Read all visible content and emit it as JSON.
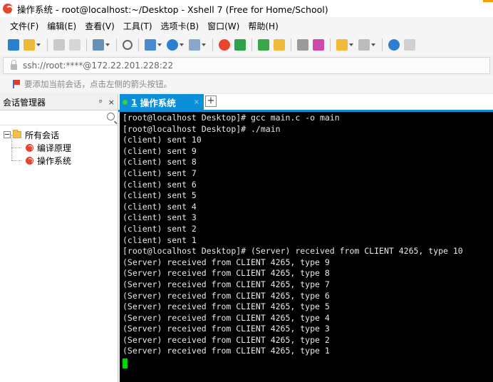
{
  "window": {
    "title": "操作系统 - root@localhost:~/Desktop - Xshell 7 (Free for Home/School)",
    "brand_color": "#e8452c"
  },
  "menu": [
    "文件(F)",
    "编辑(E)",
    "查看(V)",
    "工具(T)",
    "选项卡(B)",
    "窗口(W)",
    "帮助(H)"
  ],
  "toolbar": {
    "icons": [
      "new-session-icon",
      "open-folder-icon",
      "link-icon",
      "unlink-icon",
      "properties-icon",
      "find-icon",
      "transfer-icon",
      "globe-icon",
      "font-icon",
      "xshell-icon",
      "xftp-icon",
      "fullscreen-icon",
      "lock-icon",
      "keyboard-icon",
      "highlight-icon",
      "compose-icon",
      "layout-icon",
      "help-icon",
      "chat-icon"
    ]
  },
  "address": {
    "url": "ssh://root:****@172.22.201.228:22"
  },
  "hint": {
    "text": "要添加当前会话，点击左侧的箭头按钮。"
  },
  "sessions": {
    "title": "会话管理器",
    "pin_label": "ᵖ",
    "close_label": "×",
    "root": "所有会话",
    "items": [
      "编译原理",
      "操作系统"
    ]
  },
  "tab": {
    "index": "1",
    "label": "操作系统",
    "close": "×",
    "add": "+",
    "accent": "#0a8fd8"
  },
  "terminal": {
    "cursor_color": "#00d200",
    "lines": [
      "[root@localhost Desktop]# gcc main.c -o main",
      "[root@localhost Desktop]# ./main",
      "(client) sent 10",
      "(client) sent 9",
      "(client) sent 8",
      "(client) sent 7",
      "(client) sent 6",
      "(client) sent 5",
      "(client) sent 4",
      "(client) sent 3",
      "(client) sent 2",
      "(client) sent 1",
      "[root@localhost Desktop]# (Server) received from CLIENT 4265, type 10",
      "(Server) received from CLIENT 4265, type 9",
      "(Server) received from CLIENT 4265, type 8",
      "(Server) received from CLIENT 4265, type 7",
      "(Server) received from CLIENT 4265, type 6",
      "(Server) received from CLIENT 4265, type 5",
      "(Server) received from CLIENT 4265, type 4",
      "(Server) received from CLIENT 4265, type 3",
      "(Server) received from CLIENT 4265, type 2",
      "(Server) received from CLIENT 4265, type 1"
    ]
  }
}
